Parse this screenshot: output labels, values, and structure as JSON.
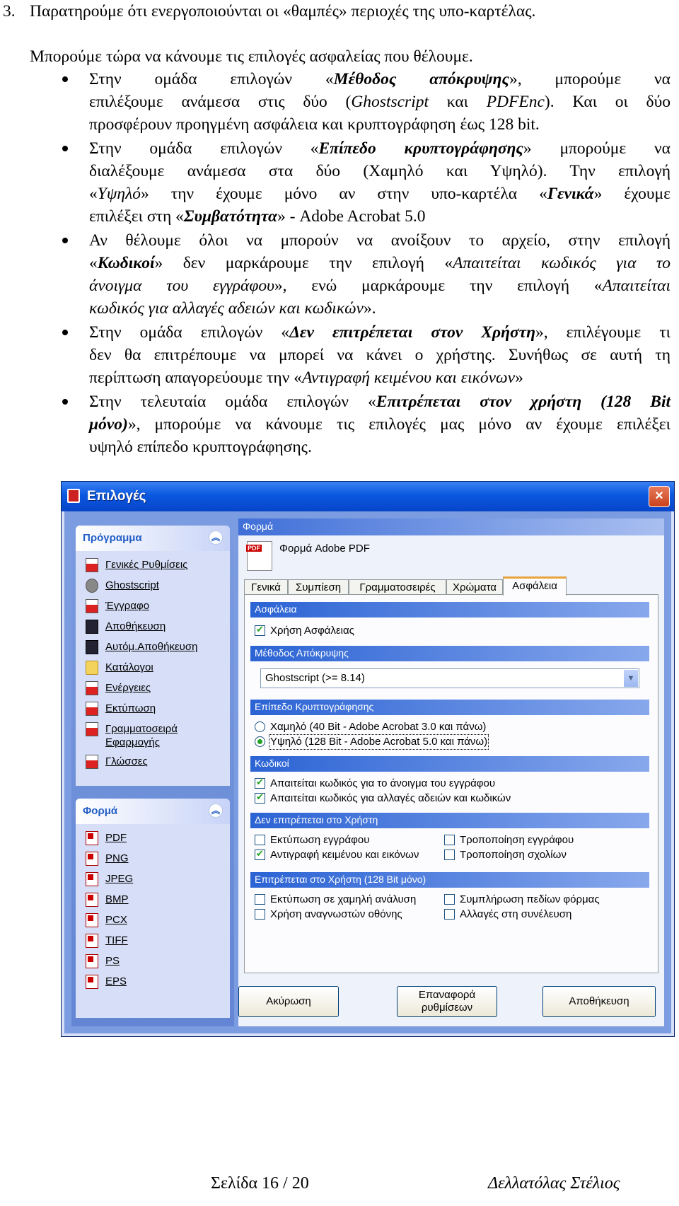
{
  "doc": {
    "item_no": "3.",
    "line1": "Παρατηρούμε ότι ενεργοποιούνται οι «θαμπές» περιοχές της υπο-καρτέλας.",
    "line2": "Μπορούμε τώρα να κάνουμε τις επιλογές ασφαλείας που θέλουμε.",
    "b1": {
      "a": "Στην ομάδα επιλογών «",
      "b": "Μέθοδος απόκρυψης",
      "c": "», μπορούμε να",
      "d": "επιλέξουμε ανάμεσα στις δύο (",
      "e": "Ghostscript",
      "f": " και ",
      "g": "PDFEnc",
      "h": "). Και οι δύο",
      "i": "προσφέρουν προηγμένη ασφάλεια και κρυπτογράφηση έως 128 bit."
    },
    "b2": {
      "a": "Στην ομάδα επιλογών «",
      "b": "Επίπεδο κρυπτογράφησης",
      "c": "» μπορούμε να",
      "d": "διαλέξουμε ανάμεσα στα δύο (Χαμηλό και Υψηλό). Την επιλογή",
      "e": "«",
      "f": "Υψηλό",
      "g": "» την έχουμε μόνο αν στην υπο-καρτέλα «",
      "h": "Γενικά",
      "i": "» έχουμε",
      "j": "επιλέξει στη «",
      "k": "Συμβατότητα",
      "l": "» - Adobe Acrobat 5.0"
    },
    "b3": {
      "a": "Αν θέλουμε όλοι να μπορούν να ανοίξουν το αρχείο, στην επιλογή",
      "b": "«",
      "c": "Κωδικοί",
      "d": "» δεν μαρκάρουμε την επιλογή «",
      "e": "Απαιτείται κωδικός για το",
      "f": "άνοιγμα του εγγράφου",
      "g": "», ενώ μαρκάρουμε την επιλογή «",
      "h": "Απαιτείται",
      "i": "κωδικός για αλλαγές αδειών και κωδικών",
      "j": "»."
    },
    "b4": {
      "a": "Στην ομάδα επιλογών «",
      "b": "Δεν επιτρέπεται στον Χρήστη",
      "c": "», επιλέγουμε τι",
      "d": "δεν θα επιτρέπουμε να μπορεί να κάνει ο χρήστης. Συνήθως σε αυτή τη",
      "e": "περίπτωση απαγορεύουμε την «",
      "f": "Αντιγραφή κειμένου και εικόνων",
      "g": "»"
    },
    "b5": {
      "a": "Στην τελευταία ομάδα επιλογών «",
      "b": "Επιτρέπεται στον χρήστη (128 Bit",
      "c": "μόνο)",
      "d": "», μπορούμε να κάνουμε τις επιλογές μας μόνο αν έχουμε επιλέξει",
      "e": "υψηλό επίπεδο κρυπτογράφησης."
    }
  },
  "window": {
    "title": "Επιλογές",
    "close": "×",
    "program_group": {
      "title": "Πρόγραμμα",
      "items": [
        {
          "label": "Γενικές Ρυθμίσεις",
          "icon": "general-settings-icon"
        },
        {
          "label": "Ghostscript",
          "icon": "ghostscript-icon"
        },
        {
          "label": "Έγγραφο",
          "icon": "document-icon"
        },
        {
          "label": "Αποθήκευση",
          "icon": "save-icon"
        },
        {
          "label": "Αυτόμ.Αποθήκευση",
          "icon": "autosave-icon"
        },
        {
          "label": "Κατάλογοι",
          "icon": "folder-icon"
        },
        {
          "label": "Ενέργειες",
          "icon": "actions-icon"
        },
        {
          "label": "Εκτύπωση",
          "icon": "print-icon"
        },
        {
          "label": "Γραμματοσειρά",
          "label2": "Εφαρμογής",
          "icon": "font-icon"
        },
        {
          "label": "Γλώσσες",
          "icon": "languages-icon"
        }
      ]
    },
    "format_group": {
      "title": "Φορμά",
      "items": [
        "PDF",
        "PNG",
        "JPEG",
        "BMP",
        "PCX",
        "TIFF",
        "PS",
        "EPS"
      ]
    },
    "panel": {
      "header": "Φορμά",
      "title": "Φορμά Adobe PDF",
      "tabs": [
        "Γενικά",
        "Συμπίεση",
        "Γραμματοσειρές",
        "Χρώματα",
        "Ασφάλεια"
      ],
      "active_tab": "Ασφάλεια",
      "security_head": "Ασφάλεια",
      "use_security": "Χρήση Ασφάλειας",
      "method_head": "Μέθοδος Απόκρυψης",
      "method_value": "Ghostscript (>= 8.14)",
      "level_head": "Επίπεδο Κρυπτογράφησης",
      "level_low": "Χαμηλό (40 Bit - Adobe Acrobat 3.0 και πάνω)",
      "level_high": "Υψηλό (128 Bit - Adobe Acrobat 5.0 και πάνω)",
      "pw_head": "Κωδικοί",
      "pw_open": "Απαιτείται κωδικός για το άνοιγμα του εγγράφου",
      "pw_change": "Απαιτείται κωδικός για αλλαγές αδειών και κωδικών",
      "deny_head": "Δεν επιτρέπεται στο Χρήστη",
      "deny_print": "Εκτύπωση εγγράφου",
      "deny_modify": "Τροποποίηση εγγράφου",
      "deny_copy": "Αντιγραφή κειμένου και εικόνων",
      "deny_comments": "Τροποποίηση σχολίων",
      "allow_head": "Επιτρέπεται στο Χρήστη (128 Bit μόνο)",
      "allow_lowres": "Εκτύπωση σε χαμηλή ανάλυση",
      "allow_fill": "Συμπλήρωση πεδίων φόρμας",
      "allow_reader": "Χρήση αναγνωστών οθόνης",
      "allow_assembly": "Αλλαγές στη συνέλευση"
    },
    "buttons": {
      "cancel": "Ακύρωση",
      "reset1": "Επαναφορά",
      "reset2": "ρυθμίσεων",
      "save": "Αποθήκευση"
    }
  },
  "footer": {
    "page": "Σελίδα 16 / 20",
    "author": "Δελλατόλας Στέλιος"
  }
}
